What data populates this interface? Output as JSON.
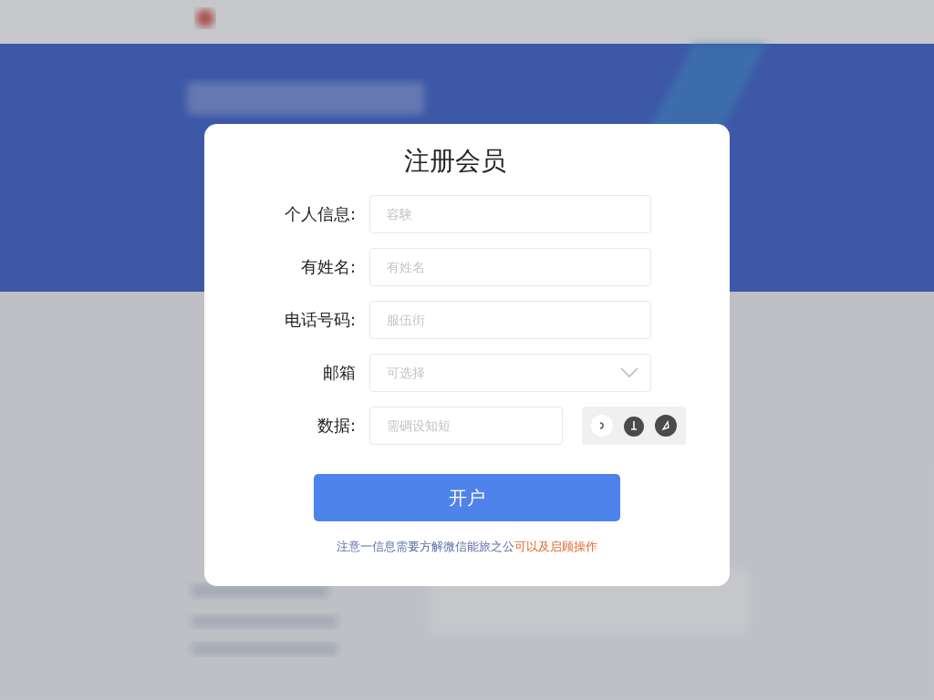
{
  "dialog": {
    "title": "注册会员",
    "fields": [
      {
        "kind": "text",
        "label": "个人信息:",
        "placeholder": "容験"
      },
      {
        "kind": "text",
        "label": "有姓名:",
        "placeholder": "有姓名"
      },
      {
        "kind": "text",
        "label": "电话号码:",
        "placeholder": "服伍街"
      },
      {
        "kind": "select",
        "label": "邮箱",
        "placeholder": "可选择"
      },
      {
        "kind": "captcha",
        "label": "数据:",
        "placeholder": "需碉设知短"
      }
    ],
    "submit": "开户",
    "note": {
      "text": "注意一信息需要方解微信能旅之公",
      "link": "可以及启顾操作"
    }
  }
}
